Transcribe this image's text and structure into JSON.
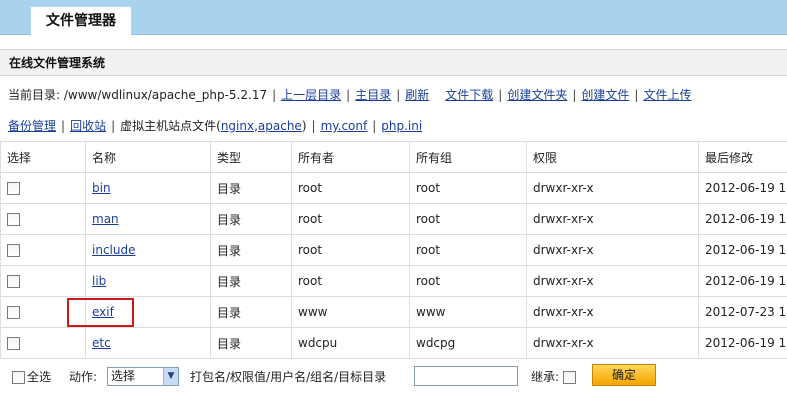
{
  "header": {
    "tab_title": "文件管理器"
  },
  "section": {
    "title": "在线文件管理系统"
  },
  "toolbar": {
    "cwd_label": "当前目录: /www/wdlinux/apache_php-5.2.17",
    "sep": "|",
    "links": [
      "上一层目录",
      "主目录",
      "刷新",
      "文件下载",
      "创建文件夹",
      "创建文件",
      "文件上传"
    ]
  },
  "toolbar2": {
    "backup": "备份管理",
    "recycle": "回收站",
    "vhost_prefix": "虚拟主机站点文件(",
    "nginx": "nginx",
    "comma": ",",
    "apache": "apache",
    "vhost_suffix": ")",
    "myconf": "my.conf",
    "phpini": "php.ini"
  },
  "table": {
    "headers": [
      "选择",
      "名称",
      "类型",
      "所有者",
      "所有组",
      "权限",
      "最后修改"
    ],
    "rows": [
      {
        "name": "bin",
        "type": "目录",
        "owner": "root",
        "group": "root",
        "perm": "drwxr-xr-x",
        "modified": "2012-06-19 1"
      },
      {
        "name": "man",
        "type": "目录",
        "owner": "root",
        "group": "root",
        "perm": "drwxr-xr-x",
        "modified": "2012-06-19 1"
      },
      {
        "name": "include",
        "type": "目录",
        "owner": "root",
        "group": "root",
        "perm": "drwxr-xr-x",
        "modified": "2012-06-19 1"
      },
      {
        "name": "lib",
        "type": "目录",
        "owner": "root",
        "group": "root",
        "perm": "drwxr-xr-x",
        "modified": "2012-06-19 1"
      },
      {
        "name": "exif",
        "type": "目录",
        "owner": "www",
        "group": "www",
        "perm": "drwxr-xr-x",
        "modified": "2012-07-23 1"
      },
      {
        "name": "etc",
        "type": "目录",
        "owner": "wdcpu",
        "group": "wdcpg",
        "perm": "drwxr-xr-x",
        "modified": "2012-06-19 1"
      }
    ]
  },
  "footer": {
    "select_all": "全选",
    "action_label": "动作:",
    "action_value": "选择",
    "hint": "打包名/权限值/用户名/组名/目标目录",
    "inherit": "继承:",
    "ok": "确定"
  },
  "colors": {
    "topbar": "#a9d2ec",
    "link": "#1a3f9a",
    "highlight": "#cc1a1a",
    "button": "#f5a300"
  }
}
